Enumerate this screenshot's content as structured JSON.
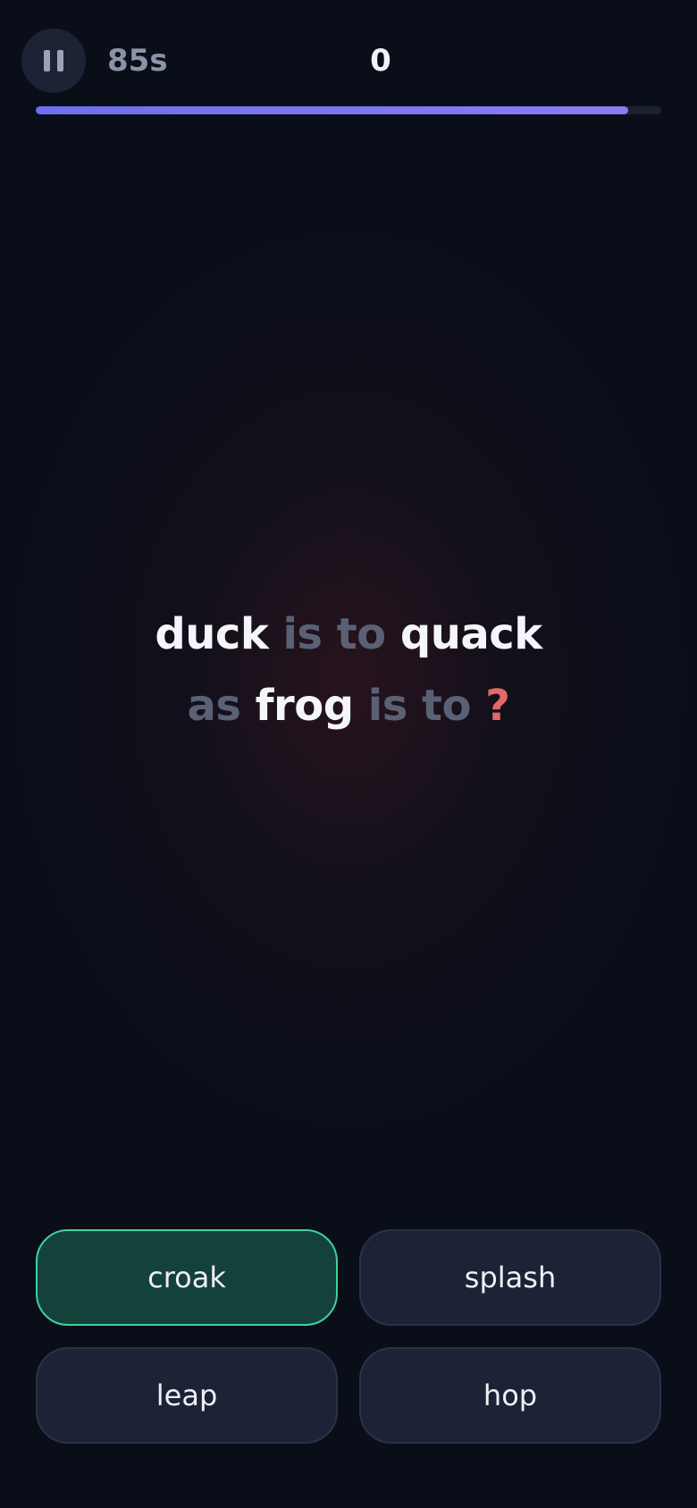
{
  "header": {
    "timer": "85s",
    "score": "0",
    "progress": 0.947
  },
  "question": {
    "line1": {
      "word_a": "duck",
      "connector": "is to",
      "word_b": "quack"
    },
    "line2": {
      "lead": "as",
      "word_c": "frog",
      "connector": "is to",
      "unknown": "?"
    }
  },
  "answers": [
    {
      "label": "croak",
      "state": "selected"
    },
    {
      "label": "splash",
      "state": "default"
    },
    {
      "label": "leap",
      "state": "default"
    },
    {
      "label": "hop",
      "state": "default"
    }
  ],
  "colors": {
    "background": "#0a0e19",
    "accent": "#6c6ff0",
    "selected_border": "#3ed39a",
    "selected_fill": "#14413a",
    "question_mark": "#e06a6a"
  }
}
